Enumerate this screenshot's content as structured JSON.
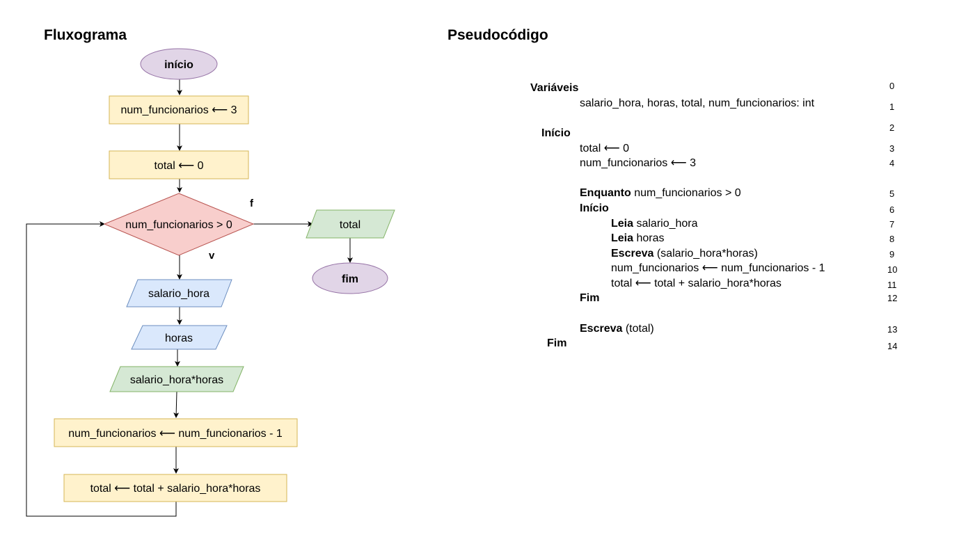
{
  "flowchart": {
    "title": "Fluxograma",
    "start": "início",
    "init_count": "num_funcionarios ⟵ 3",
    "init_total": "total ⟵ 0",
    "condition": "num_funcionarios > 0",
    "label_false": "f",
    "label_true": "v",
    "read_salary": "salario_hora",
    "read_hours": "horas",
    "output_product": "salario_hora*horas",
    "decrement": "num_funcionarios ⟵ num_funcionarios - 1",
    "accumulate": "total ⟵ total + salario_hora*horas",
    "output_total": "total",
    "end": "fim"
  },
  "pseudocode": {
    "title": "Pseudocódigo",
    "lines": [
      {
        "kw": "Variáveis",
        "text": "",
        "num": "0"
      },
      {
        "kw": "",
        "text": "salario_hora, horas, total, num_funcionarios: int",
        "num": "1"
      },
      {
        "kw": "Início",
        "text": "",
        "num": "2"
      },
      {
        "kw": "",
        "text": "total ⟵ 0",
        "num": "3"
      },
      {
        "kw": "",
        "text": "num_funcionarios ⟵ 3",
        "num": "4"
      },
      {
        "kw": "Enquanto",
        "text": " num_funcionarios > 0",
        "num": "5"
      },
      {
        "kw": "Início",
        "text": "",
        "num": "6"
      },
      {
        "kw": "Leia",
        "text": " salario_hora",
        "num": "7"
      },
      {
        "kw": "Leia",
        "text": " horas",
        "num": "8"
      },
      {
        "kw": "Escreva",
        "text": " (salario_hora*horas)",
        "num": "9"
      },
      {
        "kw": "",
        "text": "num_funcionarios ⟵ num_funcionarios - 1",
        "num": "10"
      },
      {
        "kw": "",
        "text": "total ⟵ total + salario_hora*horas",
        "num": "11"
      },
      {
        "kw": "Fim",
        "text": "",
        "num": "12"
      },
      {
        "kw": "Escreva",
        "text": " (total)",
        "num": "13"
      },
      {
        "kw": "Fim",
        "text": "",
        "num": "14"
      }
    ]
  },
  "colors": {
    "terminal_fill": "#e1d5e7",
    "terminal_stroke": "#9673a6",
    "process_fill": "#fff2cc",
    "process_stroke": "#d6b656",
    "decision_fill": "#f8cecc",
    "decision_stroke": "#b85450",
    "input_fill": "#dae8fc",
    "input_stroke": "#6c8ebf",
    "output_fill": "#d5e8d4",
    "output_stroke": "#82b366"
  }
}
